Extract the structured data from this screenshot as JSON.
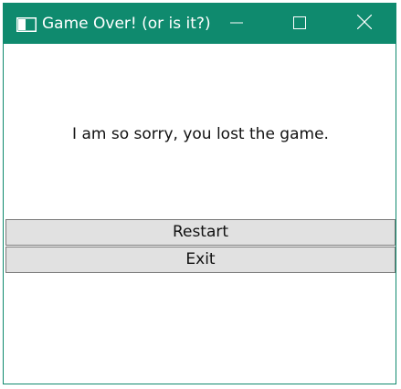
{
  "window": {
    "title": "Game Over! (or is it?)",
    "accent_color": "#0f8a6e",
    "icons": {
      "app": "window-app-icon",
      "minimize": "minimize-icon",
      "maximize": "maximize-icon",
      "close": "close-icon"
    }
  },
  "content": {
    "message": "I am so sorry, you lost the game.",
    "restart_label": "Restart",
    "exit_label": "Exit"
  }
}
